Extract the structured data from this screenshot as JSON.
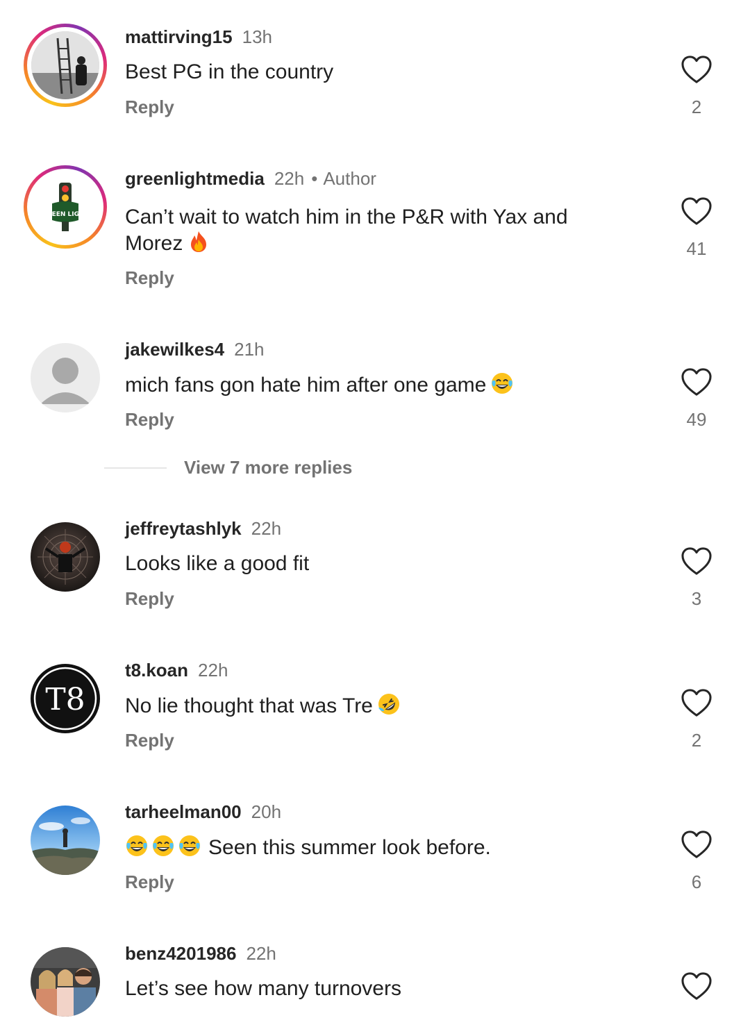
{
  "comments": [
    {
      "username": "mattirving15",
      "time": "13h",
      "text": "Best PG in the country",
      "reply": "Reply",
      "likes": "2",
      "avatar": "photo-ladder-room"
    },
    {
      "username": "greenlightmedia",
      "time": "22h",
      "author": "Author",
      "text": "Can’t wait to watch him in the P&R with Yax and Morez",
      "reply": "Reply",
      "likes": "41",
      "avatar": "green-light-logo",
      "avatar_text": "GREEN LIGHT"
    },
    {
      "username": "jakewilkes4",
      "time": "21h",
      "text": "mich fans gon hate him after one game",
      "reply": "Reply",
      "likes": "49",
      "avatar": "default-user"
    },
    {
      "username": "jeffreytashlyk",
      "time": "22h",
      "text": "Looks like a good fit",
      "reply": "Reply",
      "likes": "3",
      "avatar": "photo-dark-figure"
    },
    {
      "username": "t8.koan",
      "time": "22h",
      "text": "No lie thought that was Tre",
      "reply": "Reply",
      "likes": "2",
      "avatar": "t8-logo",
      "avatar_text": "T8"
    },
    {
      "username": "tarheelman00",
      "time": "20h",
      "text": "Seen this summer look before.",
      "reply": "Reply",
      "likes": "6",
      "avatar": "photo-landscape"
    },
    {
      "username": "benz4201986",
      "time": "22h",
      "text": "Let’s see how many turnovers",
      "reply": "Reply",
      "likes": "",
      "avatar": "photo-family"
    }
  ],
  "view_more": "View 7 more replies",
  "colors": {
    "secondary_text": "#737373",
    "primary_text": "#1f1f1f",
    "story_ring": [
      "#f9c21b",
      "#dd2a7b",
      "#8134af"
    ]
  },
  "icons": {
    "like": "heart-outline-icon",
    "fire": "fire-emoji",
    "laughing": "tears-of-joy-emoji",
    "rofl": "rolling-laughing-emoji"
  }
}
